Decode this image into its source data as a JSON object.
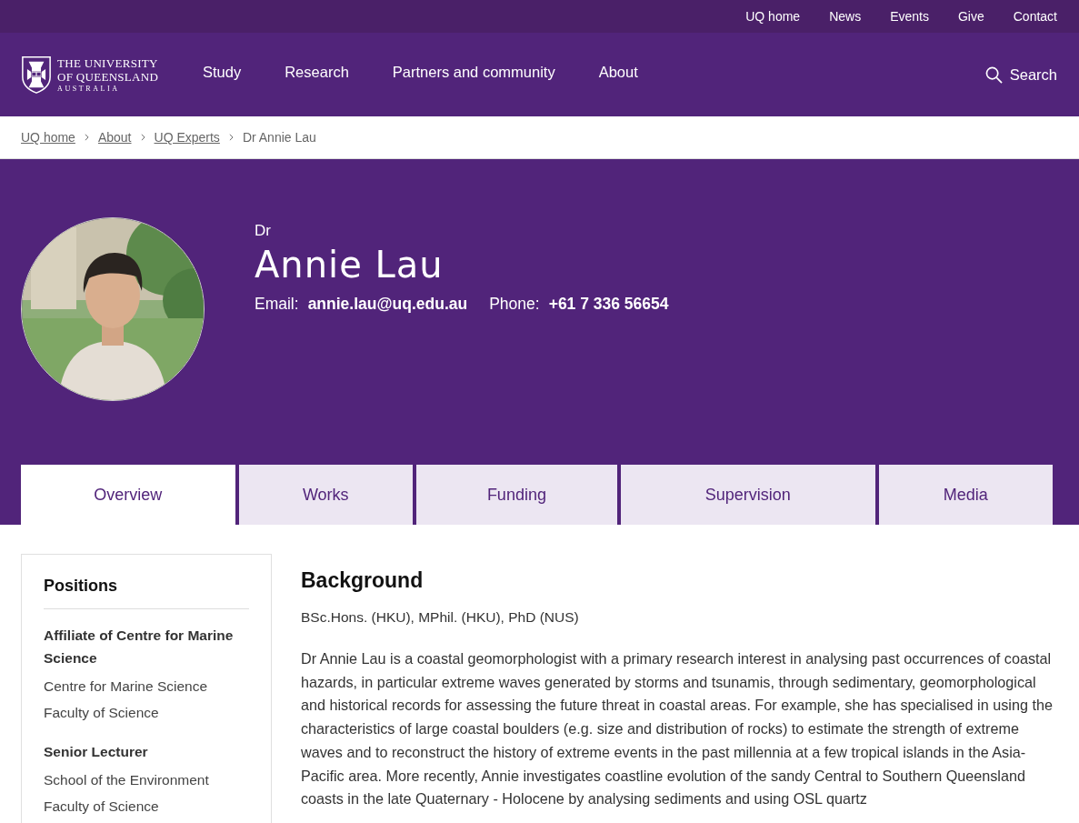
{
  "utility_nav": [
    "UQ home",
    "News",
    "Events",
    "Give",
    "Contact"
  ],
  "logo": {
    "line_1": "THE UNIVERSITY",
    "line_2": "OF QUEENSLAND",
    "line_3": "AUSTRALIA"
  },
  "main_nav": [
    "Study",
    "Research",
    "Partners and community",
    "About"
  ],
  "search": {
    "label": "Search"
  },
  "breadcrumb": [
    {
      "label": "UQ home",
      "link": true
    },
    {
      "label": "About",
      "link": true
    },
    {
      "label": "UQ Experts",
      "link": true
    },
    {
      "label": "Dr Annie Lau",
      "link": false
    }
  ],
  "profile": {
    "title": "Dr",
    "name": "Annie Lau",
    "email_label": "Email:",
    "email": "annie.lau@uq.edu.au",
    "phone_label": "Phone:",
    "phone": "+61 7 336 56654"
  },
  "tabs": [
    {
      "label": "Overview",
      "selected": true
    },
    {
      "label": "Works",
      "selected": false
    },
    {
      "label": "Funding",
      "selected": false
    },
    {
      "label": "Supervision",
      "selected": false
    },
    {
      "label": "Media",
      "selected": false
    }
  ],
  "sidebar": {
    "heading": "Positions",
    "positions": [
      {
        "title": "Affiliate of Centre for Marine Science",
        "units": [
          "Centre for Marine Science",
          "Faculty of Science"
        ]
      },
      {
        "title": "Senior Lecturer",
        "units": [
          "School of the Environment",
          "Faculty of Science"
        ]
      }
    ]
  },
  "background": {
    "heading": "Background",
    "qualifications": "BSc.Hons. (HKU), MPhil. (HKU), PhD (NUS)",
    "paragraph": "Dr Annie Lau is a coastal geomorphologist with a primary research interest in analysing past occurrences of coastal hazards, in particular extreme waves generated by storms and tsunamis, through sedimentary, geomorphological and historical records for assessing the future threat in coastal areas. For example, she has specialised in using the characteristics of large coastal boulders (e.g. size and distribution of rocks) to estimate the strength of extreme waves and to reconstruct the history of extreme events in the past millennia at a few tropical islands in the Asia-Pacific area. More recently, Annie investigates coastline evolution of the sandy Central to Southern Queensland coasts in the late Quaternary - Holocene by analysing sediments and using OSL quartz"
  }
}
